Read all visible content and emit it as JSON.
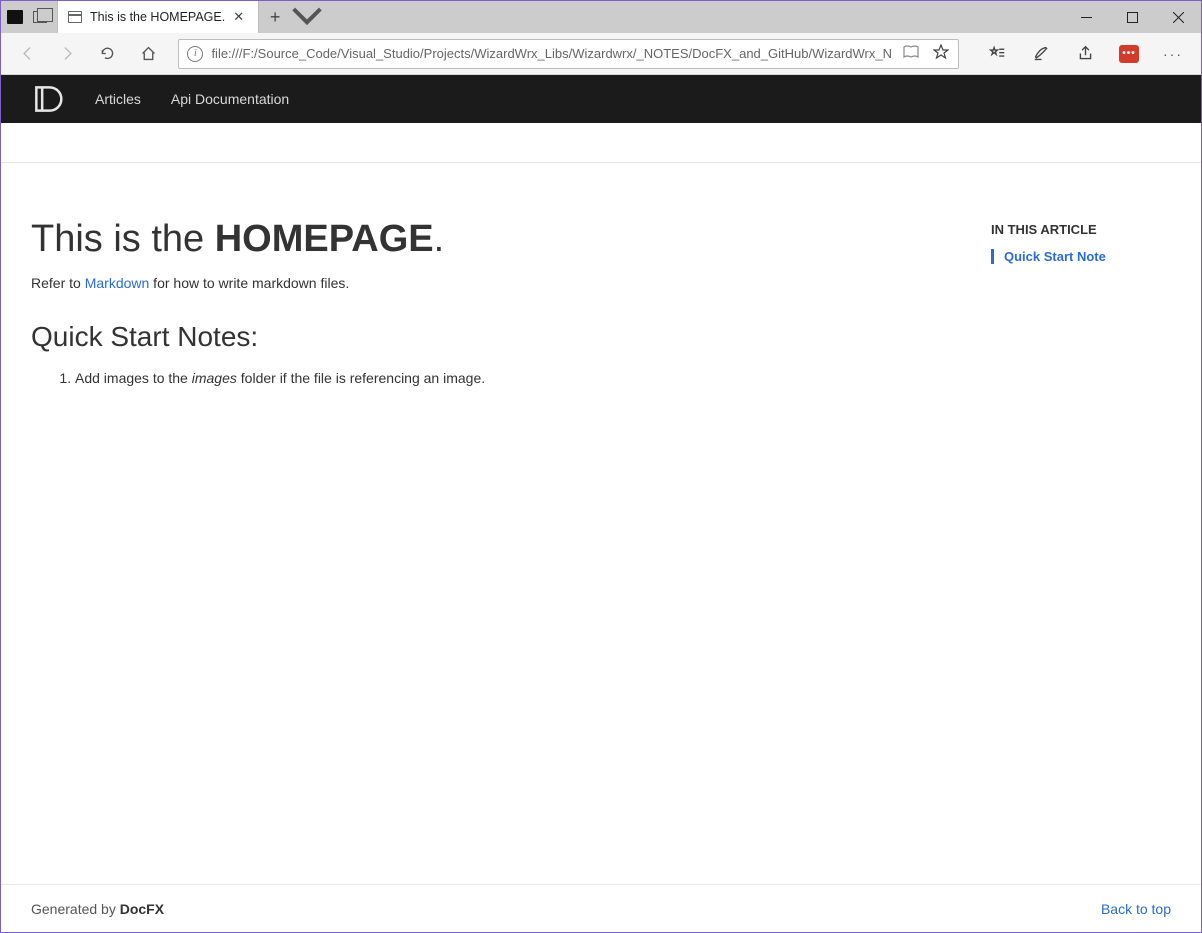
{
  "window": {
    "tab_title": "This is the HOMEPAGE."
  },
  "address": {
    "scheme_label": "i",
    "url": "file:///F:/Source_Code/Visual_Studio/Projects/WizardWrx_Libs/Wizardwrx/_NOTES/DocFX_and_GitHub/WizardWrx_N"
  },
  "nav": {
    "link1": "Articles",
    "link2": "Api Documentation"
  },
  "page": {
    "title_prefix": "This is the ",
    "title_bold": "HOMEPAGE",
    "title_suffix": ".",
    "intro_before": "Refer to ",
    "intro_link": "Markdown",
    "intro_after": " for how to write markdown files.",
    "section_heading": "Quick Start Notes:",
    "note_before": "Add images to the ",
    "note_italic": "images",
    "note_after": " folder if the file is referencing an image."
  },
  "aside": {
    "title": "IN THIS ARTICLE",
    "item1": "Quick Start Note"
  },
  "footer": {
    "generated_by_prefix": "Generated by ",
    "generated_by_brand": "DocFX",
    "back_to_top": "Back to top"
  }
}
